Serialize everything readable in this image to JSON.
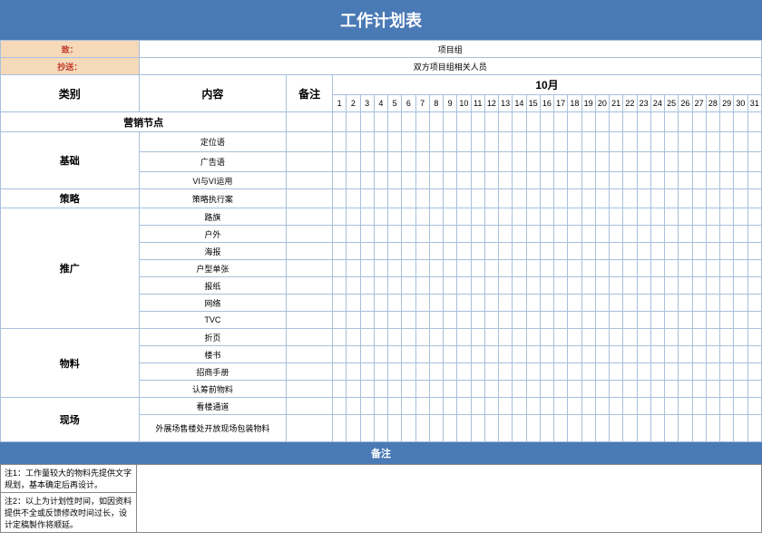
{
  "title": "工作计划表",
  "to_label": "致：",
  "to_value": "项目组",
  "cc_label": "抄送：",
  "cc_value": "双方项目组相关人员",
  "col_category": "类别",
  "col_content": "内容",
  "col_remark": "备注",
  "month_label": "10月",
  "days": [
    "1",
    "2",
    "3",
    "4",
    "5",
    "6",
    "7",
    "8",
    "9",
    "10",
    "11",
    "12",
    "13",
    "14",
    "15",
    "16",
    "17",
    "18",
    "19",
    "20",
    "21",
    "22",
    "23",
    "24",
    "25",
    "26",
    "27",
    "28",
    "29",
    "30",
    "31"
  ],
  "section_marketing": "营销节点",
  "cat_basic": "基础",
  "basic_items": [
    "定位语",
    "广告语",
    "VI与VI运用"
  ],
  "cat_strategy": "策略",
  "strategy_items": [
    "策略执行案"
  ],
  "cat_promo": "推广",
  "promo_items": [
    "路旗",
    "户外",
    "海报",
    "户型单张",
    "报纸",
    "网络",
    "TVC"
  ],
  "cat_material": "物料",
  "material_items": [
    "折页",
    "楼书",
    "招商手册",
    "认筹前物料"
  ],
  "cat_site": "现场",
  "site_items": [
    "看楼通道",
    "外展场售楼处开放现场包装物料"
  ],
  "footer_label": "备注",
  "note1": "注1：工作量较大的物料先提供文字规划，基本确定后再设计。",
  "note2": "注2：以上为计划性时间，如因资料提供不全或反馈修改时间过长，设计定稿製作将顺延。"
}
